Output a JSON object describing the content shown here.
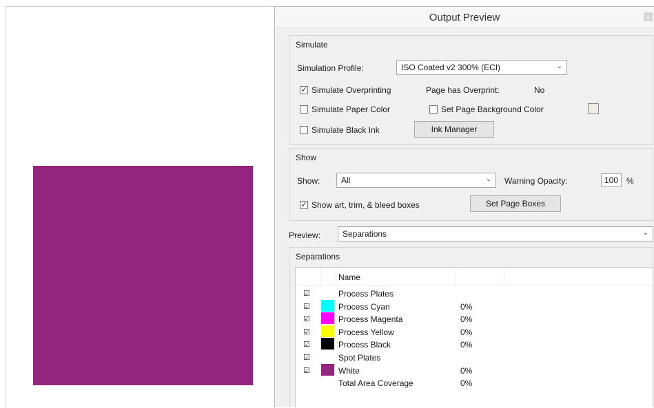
{
  "dialog": {
    "title": "Output Preview",
    "close_glyph": "x"
  },
  "document": {
    "swatch_color": "#95267f"
  },
  "simulate": {
    "group_label": "Simulate",
    "profile_label": "Simulation Profile:",
    "profile_value": "ISO Coated v2 300% (ECI)",
    "overprinting_label": "Simulate Overprinting",
    "overprinting_checked": true,
    "page_has_overprint_label": "Page has Overprint:",
    "page_has_overprint_value": "No",
    "paper_color_label": "Simulate Paper Color",
    "page_bg_label": "Set Page Background Color",
    "black_ink_label": "Simulate Black Ink",
    "ink_manager_label": "Ink Manager"
  },
  "show": {
    "group_label": "Show",
    "show_label": "Show:",
    "show_value": "All",
    "warning_opacity_label": "Warning Opacity:",
    "warning_opacity_value": "100",
    "percent": "%",
    "boxes_label": "Show art, trim, & bleed boxes",
    "set_page_boxes_label": "Set Page Boxes"
  },
  "preview": {
    "label": "Preview:",
    "value": "Separations"
  },
  "separations": {
    "group_label": "Separations",
    "col_name": "Name",
    "rows": [
      {
        "name": "Process Plates",
        "pct": "",
        "color": "",
        "checked": true
      },
      {
        "name": "Process Cyan",
        "pct": "0%",
        "color": "#00ffff",
        "checked": true
      },
      {
        "name": "Process Magenta",
        "pct": "0%",
        "color": "#ff00ff",
        "checked": true
      },
      {
        "name": "Process Yellow",
        "pct": "0%",
        "color": "#ffff00",
        "checked": true
      },
      {
        "name": "Process Black",
        "pct": "0%",
        "color": "#000000",
        "checked": true
      },
      {
        "name": "Spot Plates",
        "pct": "",
        "color": "",
        "checked": true
      },
      {
        "name": "White",
        "pct": "0%",
        "color": "#95267f",
        "checked": true
      },
      {
        "name": "Total Area Coverage",
        "pct": "0%",
        "color": "",
        "checked": false
      }
    ]
  }
}
